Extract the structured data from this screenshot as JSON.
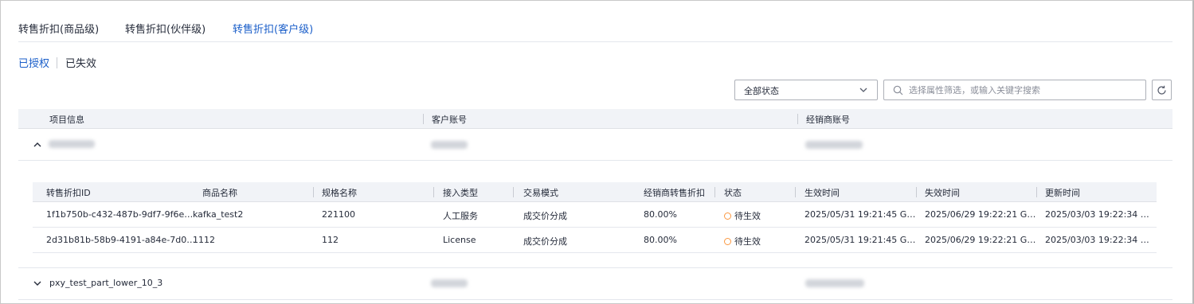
{
  "tabs": [
    {
      "label": "转售折扣(商品级)",
      "active": false
    },
    {
      "label": "转售折扣(伙伴级)",
      "active": false
    },
    {
      "label": "转售折扣(客户级)",
      "active": true
    }
  ],
  "subtabs": [
    {
      "label": "已授权",
      "active": true
    },
    {
      "label": "已失效",
      "active": false
    }
  ],
  "filter": {
    "status_select_value": "全部状态"
  },
  "search": {
    "placeholder": "选择属性筛选，或输入关键字搜索"
  },
  "outer_table": {
    "headers": [
      "项目信息",
      "客户账号",
      "经销商账号"
    ],
    "rows": [
      {
        "project": "",
        "expanded": true,
        "customer_account": "",
        "dealer_account": ""
      },
      {
        "project": "pxy_test_part_lower_10_3",
        "expanded": false,
        "customer_account": "",
        "dealer_account": ""
      }
    ]
  },
  "inner_table": {
    "headers": [
      "转售折扣ID",
      "商品名称",
      "规格名称",
      "接入类型",
      "交易模式",
      "经销商转售折扣",
      "状态",
      "生效时间",
      "失效时间",
      "更新时间"
    ],
    "rows": [
      {
        "id": "1f1b750b-c432-487b-9df7-9f6e9f...",
        "product": "kafka_test2",
        "spec": "221100",
        "access_type": "人工服务",
        "trade_mode": "成交价分成",
        "discount": "80.00%",
        "status": "待生效",
        "effective_time": "2025/05/31 19:21:45 GM...",
        "expire_time": "2025/06/29 19:22:21 GM...",
        "update_time": "2025/03/03 19:22:34 G..."
      },
      {
        "id": "2d31b81b-58b9-4191-a84e-7d08...",
        "product": "1112",
        "spec": "112",
        "access_type": "License",
        "trade_mode": "成交价分成",
        "discount": "80.00%",
        "status": "待生效",
        "effective_time": "2025/05/31 19:21:45 GM...",
        "expire_time": "2025/06/29 19:22:21 GM...",
        "update_time": "2025/03/03 19:22:34 G..."
      }
    ]
  },
  "colors": {
    "accent": "#1a5ec9",
    "pending_status": "#fa9841",
    "header_bg": "#f1f3f7"
  },
  "icons": [
    "chevron-down-icon",
    "search-icon",
    "refresh-icon",
    "chevron-up-icon",
    "pending-status-icon"
  ]
}
